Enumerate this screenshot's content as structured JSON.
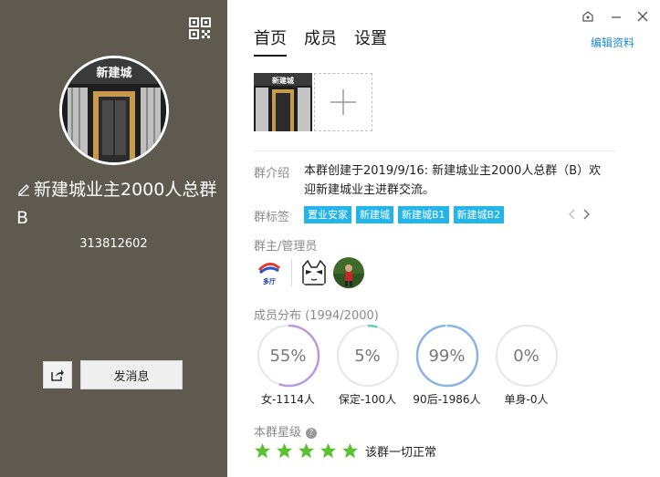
{
  "left": {
    "group_name": "新建城业主2000人总群B",
    "group_id": "313812602",
    "avatar_sign": "新建城",
    "send_message_label": "发消息"
  },
  "tabs": [
    {
      "label": "首页",
      "active": true
    },
    {
      "label": "成员",
      "active": false
    },
    {
      "label": "设置",
      "active": false
    }
  ],
  "edit_link": "编辑资料",
  "intro": {
    "label": "群介绍",
    "text": "本群创建于2019/9/16:  新建城业主2000人总群（B）欢迎新建城业主进群交流。"
  },
  "tags": {
    "label": "群标签",
    "items": [
      "置业安家",
      "新建城",
      "新建城B1",
      "新建城B2"
    ]
  },
  "admins": {
    "label": "群主/管理员",
    "logo_text": "多厅"
  },
  "members": {
    "label": "成员分布 (1994/2000)",
    "stats": [
      {
        "value": "55%",
        "fraction": 0.55,
        "caption": "女-1114人",
        "color": "#b79be0"
      },
      {
        "value": "5%",
        "fraction": 0.05,
        "caption": "保定-100人",
        "color": "#5fd0b8"
      },
      {
        "value": "99%",
        "fraction": 0.99,
        "caption": "90后-1986人",
        "color": "#8ab4e6"
      },
      {
        "value": "0%",
        "fraction": 0.0,
        "caption": "单身-0人",
        "color": "#cccccc"
      }
    ]
  },
  "rating": {
    "label": "本群星级",
    "stars": 5,
    "text": "该群一切正常",
    "star_color": "#5cc135"
  }
}
